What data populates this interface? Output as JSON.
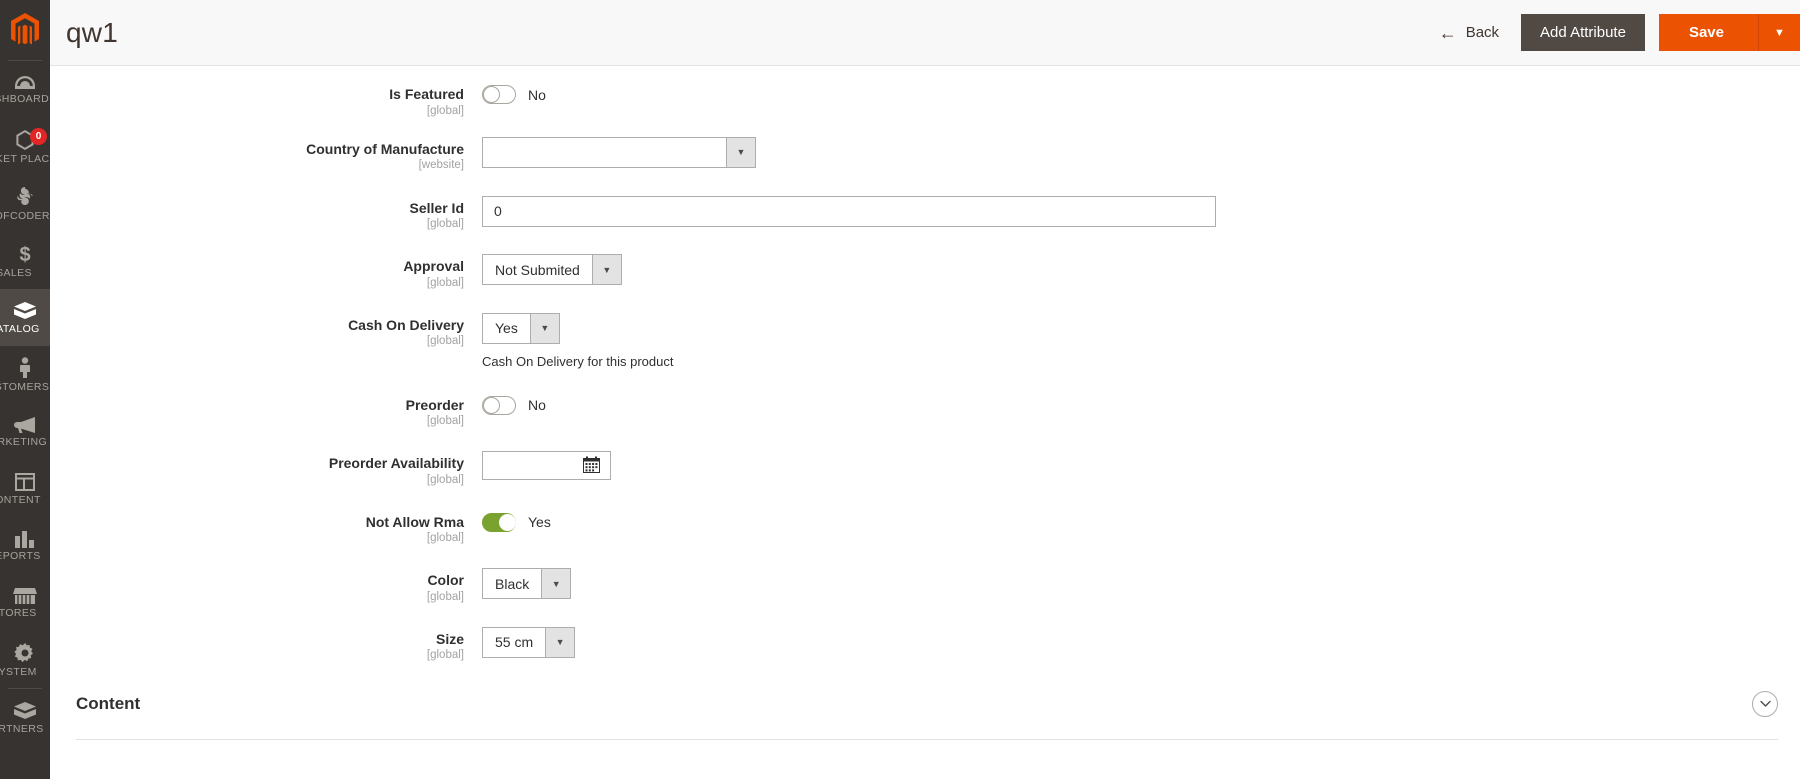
{
  "sidebar": {
    "logo_name": "magento-logo",
    "items": [
      {
        "label": "DASHBOARD",
        "icon": "dashboard-icon",
        "active": false,
        "badge": null
      },
      {
        "label": "MARKET PLACE",
        "icon": "hexagon-icon",
        "active": false,
        "badge": "0"
      },
      {
        "label": "ODOFCODER",
        "icon": "swirl-icon",
        "active": false,
        "badge": null
      },
      {
        "label": "SALES",
        "icon": "dollar-icon",
        "active": false,
        "badge": null
      },
      {
        "label": "CATALOG",
        "icon": "box-icon",
        "active": true,
        "badge": null
      },
      {
        "label": "CUSTOMERS",
        "icon": "person-icon",
        "active": false,
        "badge": null
      },
      {
        "label": "MARKETING",
        "icon": "megaphone-icon",
        "active": false,
        "badge": null
      },
      {
        "label": "CONTENT",
        "icon": "layout-icon",
        "active": false,
        "badge": null
      },
      {
        "label": "REPORTS",
        "icon": "bar-chart-icon",
        "active": false,
        "badge": null
      },
      {
        "label": "STORES",
        "icon": "storefront-icon",
        "active": false,
        "badge": null
      },
      {
        "label": "SYSTEM",
        "icon": "gear-icon",
        "active": false,
        "badge": null
      },
      {
        "label": "PARTNERS",
        "icon": "brick-icon",
        "active": false,
        "badge": null
      }
    ]
  },
  "header": {
    "title": "qw1",
    "back_label": "Back",
    "back_icon": "arrow-left-icon",
    "add_attribute_label": "Add Attribute",
    "save_label": "Save",
    "save_caret_icon": "caret-down-icon"
  },
  "colors": {
    "accent_orange": "#eb5202",
    "sidebar_bg": "#373330",
    "toggle_on_green": "#79a22e",
    "badge_red": "#e22626"
  },
  "form": {
    "fields": [
      {
        "label": "Is Featured",
        "scope": "[global]",
        "type": "toggle",
        "value": "No",
        "on": false
      },
      {
        "label": "Country of Manufacture",
        "scope": "[website]",
        "type": "select-wide",
        "value": "",
        "caret": "▼"
      },
      {
        "label": "Seller Id",
        "scope": "[global]",
        "type": "text",
        "value": "0",
        "placeholder": ""
      },
      {
        "label": "Approval",
        "scope": "[global]",
        "type": "select",
        "value": "Not Submited",
        "caret": "▼"
      },
      {
        "label": "Cash On Delivery",
        "scope": "[global]",
        "type": "select",
        "value": "Yes",
        "caret": "▼",
        "note": "Cash On Delivery for this product"
      },
      {
        "label": "Preorder",
        "scope": "[global]",
        "type": "toggle",
        "value": "No",
        "on": false
      },
      {
        "label": "Preorder Availability",
        "scope": "[global]",
        "type": "date",
        "value": "",
        "placeholder": "",
        "icon": "calendar-icon"
      },
      {
        "label": "Not Allow Rma",
        "scope": "[global]",
        "type": "toggle",
        "value": "Yes",
        "on": true
      },
      {
        "label": "Color",
        "scope": "[global]",
        "type": "select",
        "value": "Black",
        "caret": "▼"
      },
      {
        "label": "Size",
        "scope": "[global]",
        "type": "select",
        "value": "55 cm",
        "caret": "▼"
      }
    ]
  },
  "content_section": {
    "title": "Content",
    "toggle_icon": "chevron-down-icon",
    "toggle_glyph": "⌄",
    "expanded": false
  }
}
